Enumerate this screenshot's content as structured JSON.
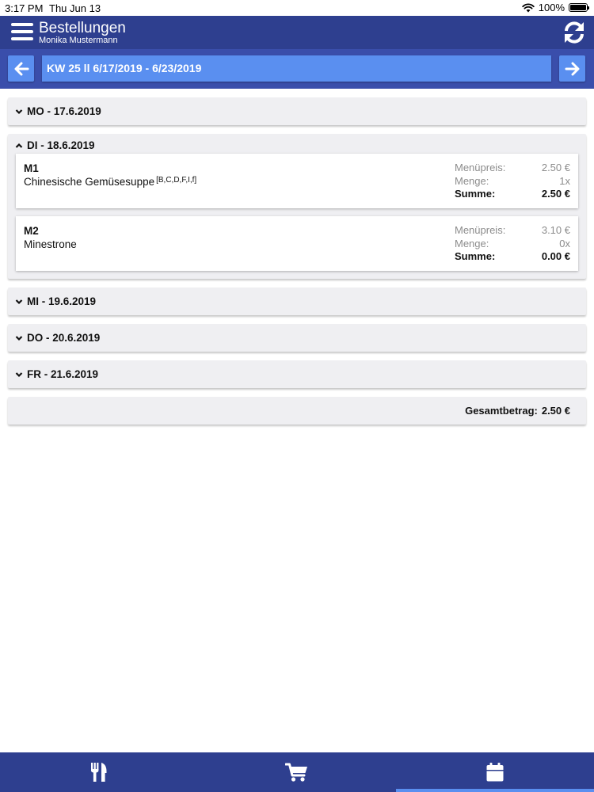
{
  "status": {
    "time": "3:17 PM",
    "date": "Thu Jun 13",
    "battery": "100%",
    "icons": [
      "wifi-icon",
      "battery-icon"
    ]
  },
  "header": {
    "title": "Bestellungen",
    "subtitle": "Monika Mustermann",
    "icons": [
      "menu-icon",
      "refresh-icon"
    ]
  },
  "week": {
    "label": "KW 25 ll 6/17/2019 - 6/23/2019",
    "icons": [
      "arrow-left-icon",
      "arrow-right-icon"
    ]
  },
  "labels": {
    "price": "Menüpreis:",
    "qty": "Menge:",
    "sum": "Summe:"
  },
  "days": [
    {
      "label": "MO - 17.6.2019",
      "expanded": false,
      "items": []
    },
    {
      "label": "DI - 18.6.2019",
      "expanded": true,
      "items": [
        {
          "code": "M1",
          "name": "Chinesische Gemüsesuppe",
          "allergens": "[B,C,D,F,I,f]",
          "price": "2.50 €",
          "qty": "1x",
          "sum": "2.50 €"
        },
        {
          "code": "M2",
          "name": "Minestrone",
          "allergens": "",
          "price": "3.10 €",
          "qty": "0x",
          "sum": "0.00 €"
        }
      ]
    },
    {
      "label": "MI - 19.6.2019",
      "expanded": false,
      "items": []
    },
    {
      "label": "DO - 20.6.2019",
      "expanded": false,
      "items": []
    },
    {
      "label": "FR - 21.6.2019",
      "expanded": false,
      "items": []
    }
  ],
  "total": {
    "label": "Gesamtbetrag:",
    "value": "2.50 €"
  },
  "tabs": [
    {
      "icon": "fork-knife-icon",
      "active": false
    },
    {
      "icon": "cart-icon",
      "active": false
    },
    {
      "icon": "calendar-icon",
      "active": true
    }
  ],
  "colors": {
    "header": "#2e3f8f",
    "weekbar": "#3a4eab",
    "accent": "#5a8ff0",
    "section": "#efeff2"
  }
}
